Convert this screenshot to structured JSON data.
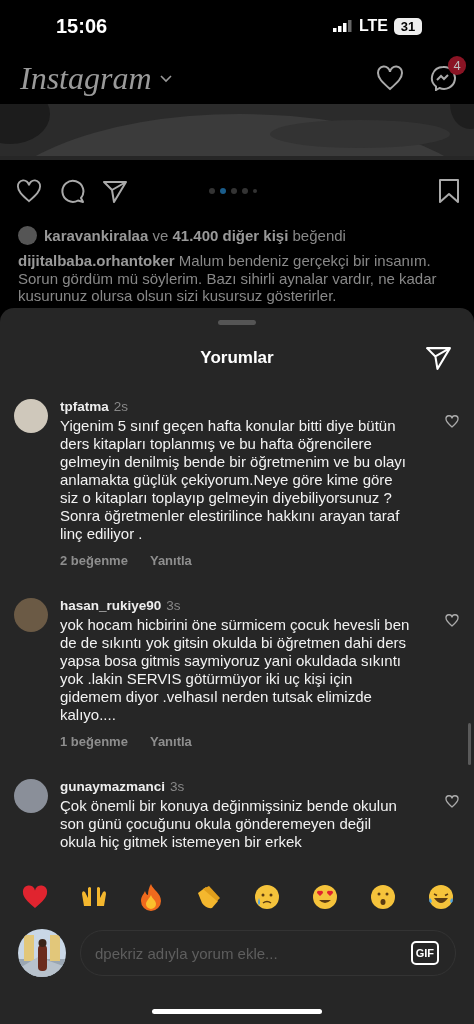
{
  "status_bar": {
    "time": "15:06",
    "network": "LTE",
    "battery": "31"
  },
  "header": {
    "logo": "Instagram",
    "badge": "4"
  },
  "post": {
    "carousel_dots": [
      {
        "selected": false
      },
      {
        "selected": true
      },
      {
        "selected": false
      },
      {
        "selected": false
      },
      {
        "selected": false
      }
    ],
    "likes": "**karavankiralaa** ve **41.400 diğer kişi** beğendi",
    "caption": "**dijitalbaba.orhantoker** Malum bendeniz gerçekçi bir insanım. Sorun gördüm mü söylerim. Bazı sihirli aynalar vardır, ne kadar kusurunuz olursa olsun sizi kusursuz gösterirler."
  },
  "comments_sheet": {
    "title": "Yorumlar",
    "comments": [
      {
        "username": "tpfatma",
        "time": "2s",
        "text": "Yigenim 5 sınıf geçen hafta konular bitti diye bütün ders kitapları toplanmış ve bu hafta öğrencilere gelmeyin denilmiş bende bir öğretmenim ve bu olayı anlamakta güçlük çekiyorum.Neye göre kime göre siz o kitapları toplayıp gelmeyin diyebiliyorsunuz ? Sonra öğretmenler elestirilince hakkını arayan taraf linç ediliyor .",
        "likes": "2 beğenme",
        "reply": "Yanıtla",
        "liked": false,
        "color": "#cfc8bb"
      },
      {
        "username": "hasan_rukiye90",
        "time": "3s",
        "text": "yok hocam hicbirini öne sürmicem çocuk hevesli ben de de sıkıntı yok gitsin okulda bi öğretmen dahi ders yapsa bosa gitmis saymiyoruz yani okuldada sıkıntı yok .lakin SERVIS götürmüyor iki uç kişi için gidemem diyor .velhasıl nerden tutsak elimizde kalıyo....",
        "likes": "1 beğenme",
        "reply": "Yanıtla",
        "liked": false,
        "color": "#6b5a45"
      },
      {
        "username": "gunaymazmanci",
        "time": "3s",
        "text": "Çok önemli bir konuya değinmişsiniz bende okulun son günü çocuğunu okula gönderemeyen değil okula hiç gitmek istemeyen bir erkek",
        "liked": false,
        "color": "#8a8f99"
      }
    ]
  },
  "composer": {
    "placeholder": "dpekriz adıyla yorum ekle...",
    "gif": "GIF"
  }
}
